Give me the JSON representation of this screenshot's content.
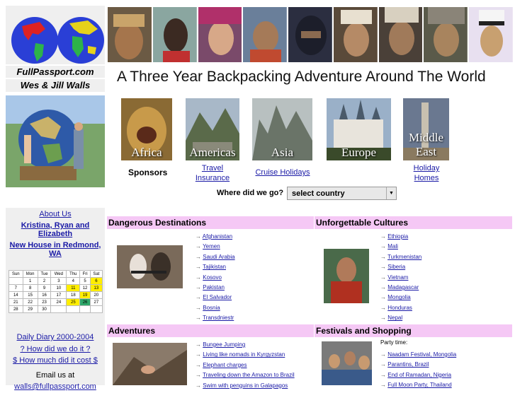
{
  "sidebar": {
    "site_name": "FullPassport.com",
    "owners": "Wes & Jill Walls",
    "links": [
      "About Us",
      "Kristina, Ryan and Elizabeth",
      "New House in Redmond, WA"
    ],
    "calendar": {
      "days": [
        "Sun",
        "Mon",
        "Tue",
        "Wed",
        "Thu",
        "Fri",
        "Sat"
      ],
      "rows": [
        [
          "",
          "1",
          "2",
          "3",
          "4",
          "5",
          "6"
        ],
        [
          "7",
          "8",
          "9",
          "10",
          "11",
          "12",
          "13"
        ],
        [
          "14",
          "15",
          "16",
          "17",
          "18",
          "19",
          "20"
        ],
        [
          "21",
          "22",
          "23",
          "24",
          "25",
          "26",
          "27"
        ],
        [
          "28",
          "29",
          "30",
          "",
          "",
          "",
          ""
        ]
      ]
    },
    "bottom_links": [
      "Daily Diary 2000-2004",
      "? How did we do it ?",
      "$ How much did it cost $"
    ],
    "email_label": "Email us at",
    "email": "walls@fullpassport.com"
  },
  "tagline": "A Three Year Backpacking Adventure Around The World",
  "continents": [
    "Africa",
    "Americas",
    "Asia",
    "Europe",
    "Middle East"
  ],
  "under_labels": {
    "sponsors": "Sponsors",
    "travel": "Travel Insurance",
    "cruise": "Cruise Holidays",
    "holiday": "Holiday Homes"
  },
  "where": {
    "label": "Where did we go?",
    "selected": "select country"
  },
  "sections": {
    "dangerous": {
      "title": "Dangerous Destinations",
      "items": [
        "Afghanistan",
        "Yemen",
        "Saudi Arabia",
        "Tajikistan",
        "Kosovo",
        "Pakistan",
        "El Salvador",
        "Bosnia",
        "Transdniestr"
      ]
    },
    "cultures": {
      "title": "Unforgettable Cultures",
      "items": [
        "Ethiopia",
        "Mali",
        "Turkmenistan",
        "Siberia",
        "Vietnam",
        "Madagascar",
        "Mongolia",
        "Honduras",
        "Nepal"
      ]
    },
    "adventures": {
      "title": "Adventures",
      "items": [
        "Bungee Jumping",
        "Living like nomads in Kyrgyzstan",
        "Elephant charges",
        "Traveling down the Amazon to Brazil",
        "Swim with penguins in Galapagos"
      ]
    },
    "festivals": {
      "title": "Festivals and Shopping",
      "intro": "Party time:",
      "items": [
        "Naadam Festival, Mongolia",
        "Parantins, Brazil",
        "End of Ramadan, Nigeria",
        "Full Moon Party, Thailand"
      ]
    }
  },
  "colors": {
    "section_header": "#f5c8f5",
    "sidebar_bg": "#efefef",
    "link": "#1a1aa6",
    "calendar_highlight": "#ffee00",
    "calendar_today": "#2fa86a"
  }
}
